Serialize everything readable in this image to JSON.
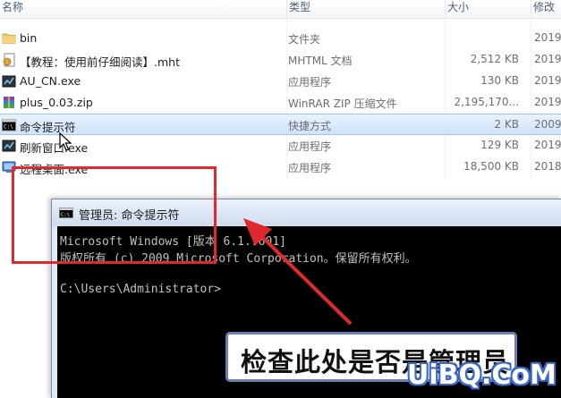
{
  "explorer": {
    "columns": {
      "name": "名称",
      "type": "类型",
      "size": "大小",
      "date": "修改"
    },
    "files": [
      {
        "name": "bin",
        "type": "文件夹",
        "size": "",
        "date": "2019",
        "icon": "folder-icon"
      },
      {
        "name": "【教程：使用前仔细阅读】.mht",
        "type": "MHTML 文档",
        "size": "2,512 KB",
        "date": "2019",
        "icon": "mht-document-icon"
      },
      {
        "name": "AU_CN.exe",
        "type": "应用程序",
        "size": "130 KB",
        "date": "2019",
        "icon": "exe-app-icon"
      },
      {
        "name": "plus_0.03.zip",
        "type": "WinRAR ZIP 压缩文件",
        "size": "2,195,170...",
        "date": "2019",
        "icon": "winrar-archive-icon"
      },
      {
        "name": "命令提示符",
        "type": "快捷方式",
        "size": "2 KB",
        "date": "2009",
        "icon": "cmd-shortcut-icon",
        "selected": true
      },
      {
        "name": "刷新窗口.exe",
        "type": "应用程序",
        "size": "129 KB",
        "date": "2019",
        "icon": "exe-app-icon"
      },
      {
        "name": "远程桌面.exe",
        "type": "应用程序",
        "size": "18,500 KB",
        "date": "2018",
        "icon": "remote-desktop-icon"
      }
    ]
  },
  "cmd_window": {
    "title": "管理员: 命令提示符",
    "lines": [
      "Microsoft Windows [版本 6.1.7601]",
      "版权所有 (c) 2009 Microsoft Corporation。保留所有权利。",
      "",
      "C:\\Users\\Administrator>"
    ]
  },
  "annotation": {
    "callout_text": "检查此处是否是管理员",
    "highlight_color": "#e0282e",
    "arrow_color": "#e0282e"
  },
  "watermark": "UiBQ.CoM",
  "colors": {
    "selection": "#cfe3fb",
    "console_bg": "#000000",
    "console_fg": "#c0c0c0"
  }
}
